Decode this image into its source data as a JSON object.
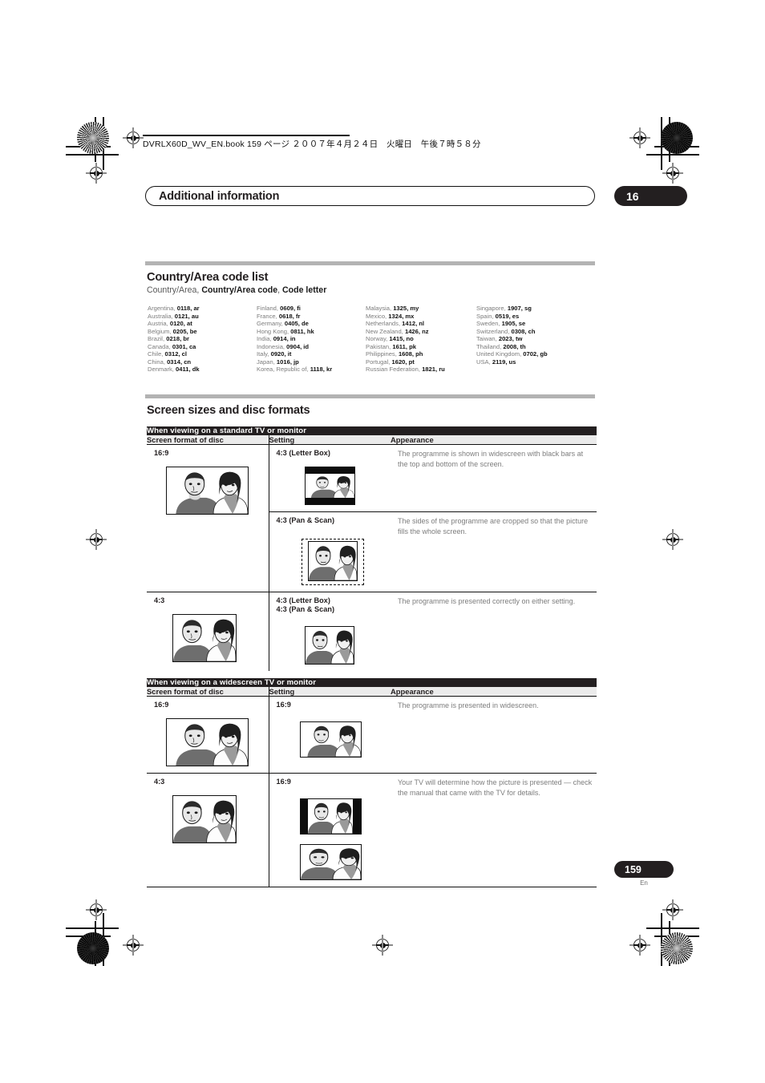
{
  "header": {
    "file_line": "DVRLX60D_WV_EN.book 159 ページ ２００７年４月２４日　火曜日　午後７時５８分",
    "running_head": "Additional information",
    "chapter_number": "16"
  },
  "footer": {
    "page_number": "159",
    "language_code": "En"
  },
  "country_section": {
    "title": "Country/Area code list",
    "legend_prefix": "Country/Area, ",
    "legend_bold_1": "Country/Area code",
    "legend_mid": ", ",
    "legend_bold_2": "Code letter",
    "columns": [
      [
        {
          "name": "Argentina, ",
          "code": "0118",
          "letter": ", ar"
        },
        {
          "name": "Australia, ",
          "code": "0121",
          "letter": ", au"
        },
        {
          "name": "Austria, ",
          "code": "0120",
          "letter": ", at"
        },
        {
          "name": "Belgium, ",
          "code": "0205",
          "letter": ", be"
        },
        {
          "name": "Brazil, ",
          "code": "0218",
          "letter": ", br"
        },
        {
          "name": "Canada, ",
          "code": "0301",
          "letter": ", ca"
        },
        {
          "name": "Chile, ",
          "code": "0312",
          "letter": ", cl"
        },
        {
          "name": "China, ",
          "code": "0314",
          "letter": ", cn"
        },
        {
          "name": "Denmark, ",
          "code": "0411",
          "letter": ", dk"
        }
      ],
      [
        {
          "name": "Finland, ",
          "code": "0609",
          "letter": ", fi"
        },
        {
          "name": "France, ",
          "code": "0618",
          "letter": ", fr"
        },
        {
          "name": "Germany, ",
          "code": "0405",
          "letter": ", de"
        },
        {
          "name": "Hong Kong, ",
          "code": "0811",
          "letter": ", hk"
        },
        {
          "name": "India, ",
          "code": "0914",
          "letter": ", in"
        },
        {
          "name": "Indonesia, ",
          "code": "0904",
          "letter": ", id"
        },
        {
          "name": "Italy, ",
          "code": "0920",
          "letter": ", it"
        },
        {
          "name": "Japan, ",
          "code": "1016",
          "letter": ", jp"
        },
        {
          "name": "Korea, Republic of, ",
          "code": "1118",
          "letter": ", kr"
        }
      ],
      [
        {
          "name": "Malaysia, ",
          "code": "1325",
          "letter": ", my"
        },
        {
          "name": "Mexico, ",
          "code": "1324",
          "letter": ", mx"
        },
        {
          "name": "Netherlands, ",
          "code": "1412",
          "letter": ", nl"
        },
        {
          "name": "New Zealand, ",
          "code": "1426",
          "letter": ", nz"
        },
        {
          "name": "Norway, ",
          "code": "1415",
          "letter": ", no"
        },
        {
          "name": "Pakistan, ",
          "code": "1611",
          "letter": ", pk"
        },
        {
          "name": "Philippines, ",
          "code": "1608",
          "letter": ", ph"
        },
        {
          "name": "Portugal, ",
          "code": "1620",
          "letter": ", pt"
        },
        {
          "name": "Russian Federation, ",
          "code": "1821",
          "letter": ", ru"
        }
      ],
      [
        {
          "name": "Singapore, ",
          "code": "1907",
          "letter": ", sg"
        },
        {
          "name": "Spain, ",
          "code": "0519",
          "letter": ", es"
        },
        {
          "name": "Sweden, ",
          "code": "1905",
          "letter": ", se"
        },
        {
          "name": "Switzerland, ",
          "code": "0308",
          "letter": ", ch"
        },
        {
          "name": "Taiwan, ",
          "code": "2023",
          "letter": ", tw"
        },
        {
          "name": "Thailand, ",
          "code": "2008",
          "letter": ", th"
        },
        {
          "name": "United Kingdom, ",
          "code": "0702",
          "letter": ", gb"
        },
        {
          "name": "USA, ",
          "code": "2119",
          "letter": ", us"
        }
      ]
    ]
  },
  "screen_section": {
    "title": "Screen sizes and disc formats",
    "table_standard": {
      "banner": "When viewing on a standard TV or monitor",
      "headers": {
        "c1": "Screen format of disc",
        "c2": "Setting",
        "c3": "Appearance"
      },
      "rows": [
        {
          "disc_format": "16:9",
          "setting": "4:3 (Letter Box)",
          "appearance": "The programme is shown in widescreen with black bars at the top and bottom of the screen."
        },
        {
          "setting": "4:3 (Pan & Scan)",
          "appearance": "The sides of the programme are cropped so that the picture fills the whole screen."
        },
        {
          "disc_format": "4:3",
          "setting": "4:3 (Letter Box)",
          "setting2": "4:3 (Pan & Scan)",
          "appearance": "The programme is presented correctly on either setting."
        }
      ]
    },
    "table_widescreen": {
      "banner": "When viewing on a widescreen TV or monitor",
      "headers": {
        "c1": "Screen format of disc",
        "c2": "Setting",
        "c3": "Appearance"
      },
      "rows": [
        {
          "disc_format": "16:9",
          "setting": "16:9",
          "appearance": "The programme is presented in widescreen."
        },
        {
          "disc_format": "4:3",
          "setting": "16:9",
          "appearance": "Your TV will determine how the picture is presented — check the manual that came with the TV for details."
        }
      ]
    }
  },
  "colors": {
    "ink": "#231f20",
    "banner_bg": "#231f20",
    "header_row_bg": "#ebebeb",
    "section_rule": "#b3b3b3",
    "body_grey": "#7d7d7d"
  },
  "marks": {
    "registration": "registration-target",
    "starburst": "density-starburst",
    "crop": "crop-corner"
  }
}
